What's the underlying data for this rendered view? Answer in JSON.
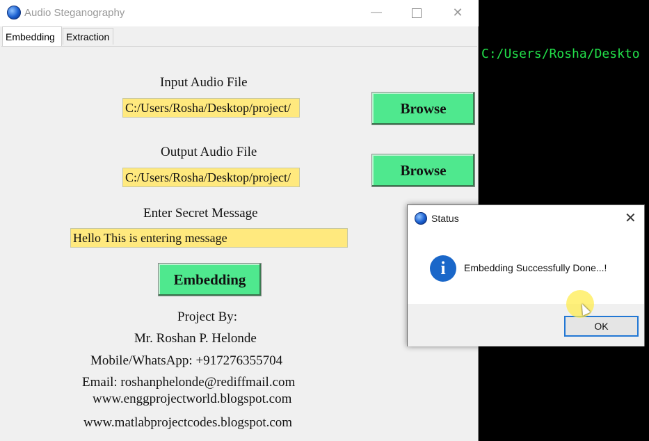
{
  "console": {
    "text": "C:/Users/Rosha/Deskto"
  },
  "window": {
    "title": "Audio Steganography",
    "tabs": [
      {
        "label": "Embedding"
      },
      {
        "label": "Extraction"
      }
    ],
    "controls": {
      "minimize": "—",
      "maximize": "",
      "close": "✕"
    }
  },
  "form": {
    "input_label": "Input Audio File",
    "input_value": "C:/Users/Rosha/Desktop/project/",
    "browse1_label": "Browse",
    "output_label": "Output Audio File",
    "output_value": "C:/Users/Rosha/Desktop/project/",
    "browse2_label": "Browse",
    "secret_label": "Enter Secret Message",
    "secret_value": "Hello This is entering message",
    "embed_label": "Embedding"
  },
  "credits": {
    "project_by": "Project By:",
    "name": "Mr. Roshan P. Helonde",
    "mobile": "Mobile/WhatsApp: +917276355704",
    "email": "Email: roshanphelonde@rediffmail.com",
    "site1": "www.enggprojectworld.blogspot.com",
    "site2": "www.matlabprojectcodes.blogspot.com"
  },
  "dialog": {
    "title": "Status",
    "close": "✕",
    "info_glyph": "i",
    "message": "Embedding Successfully Done...!",
    "ok_label": "OK"
  },
  "colors": {
    "field_bg": "#ffe97e",
    "button_bg": "#4fe88e",
    "console_text": "#22e04a",
    "info_icon": "#1a67c9",
    "ok_border": "#2277d4"
  },
  "icons": [
    "app-logo-icon",
    "minimize-icon",
    "maximize-icon",
    "close-icon",
    "info-icon",
    "mouse-cursor-icon"
  ]
}
